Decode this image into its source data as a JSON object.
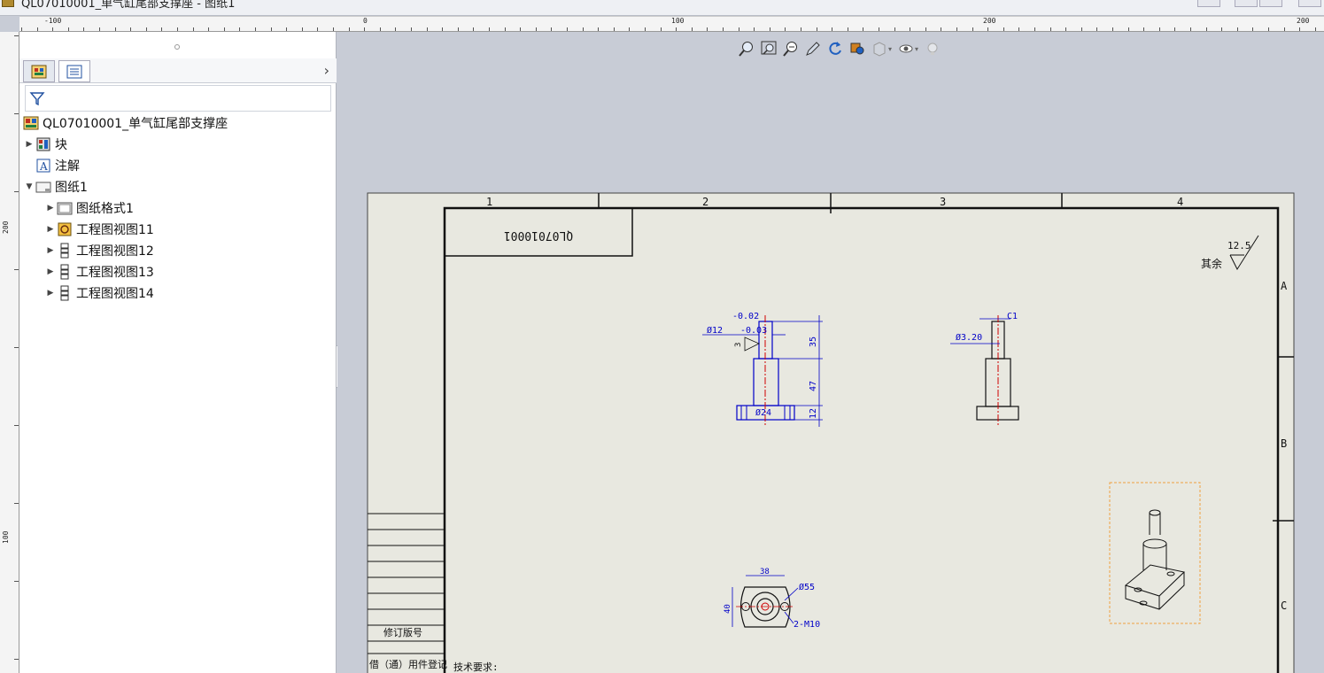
{
  "window": {
    "title": "QL07010001_单气缸尾部支撑座 - 图纸1"
  },
  "ruler": {
    "top_labels": [
      "-100",
      "0",
      "100",
      "200",
      "200"
    ],
    "left_labels": [
      "200",
      "100"
    ]
  },
  "panel": {
    "tabs": [
      "feature-manager-tab",
      "property-manager-tab"
    ],
    "tree": {
      "root": "QL07010001_单气缸尾部支撑座",
      "items": [
        {
          "label": "块",
          "icon": "block-icon",
          "expandable": true
        },
        {
          "label": "注解",
          "icon": "annotation-icon",
          "expandable": false
        },
        {
          "label": "图纸1",
          "icon": "sheet-icon",
          "expanded": true
        },
        {
          "label": "图纸格式1",
          "icon": "sheet-format-icon",
          "expandable": true
        },
        {
          "label": "工程图视图11",
          "icon": "drawing-view-icon",
          "expandable": true
        },
        {
          "label": "工程图视图12",
          "icon": "drawing-view-icon",
          "expandable": true
        },
        {
          "label": "工程图视图13",
          "icon": "drawing-view-icon",
          "expandable": true
        },
        {
          "label": "工程图视图14",
          "icon": "drawing-view-icon",
          "expandable": true
        }
      ]
    }
  },
  "drawing": {
    "zone_columns": [
      "1",
      "2",
      "3",
      "4"
    ],
    "zone_rows": [
      "A",
      "B",
      "C"
    ],
    "part_number_box": "QL07010001",
    "surface_finish": {
      "text": "其余",
      "value": "12.5"
    },
    "dims": {
      "tol_upper": "-0.02",
      "tol_lower": "-0.03",
      "dia12": "Ø12",
      "dia24": "Ø24",
      "len35": "35",
      "len47": "47",
      "len12": "12",
      "small3": "3",
      "c1": "C1",
      "dia320": "Ø3.20",
      "w38": "38",
      "h40": "40",
      "dia55": "Ø55",
      "holes": "2-M10"
    },
    "revision_label": "修订版号",
    "borrow_label": "借（通）用件登记",
    "tech_req": "技术要求:"
  },
  "colors": {
    "sheet": "#e8e8e0",
    "dim": "#0000c8",
    "center": "#d00000",
    "select": "#f0a040"
  }
}
